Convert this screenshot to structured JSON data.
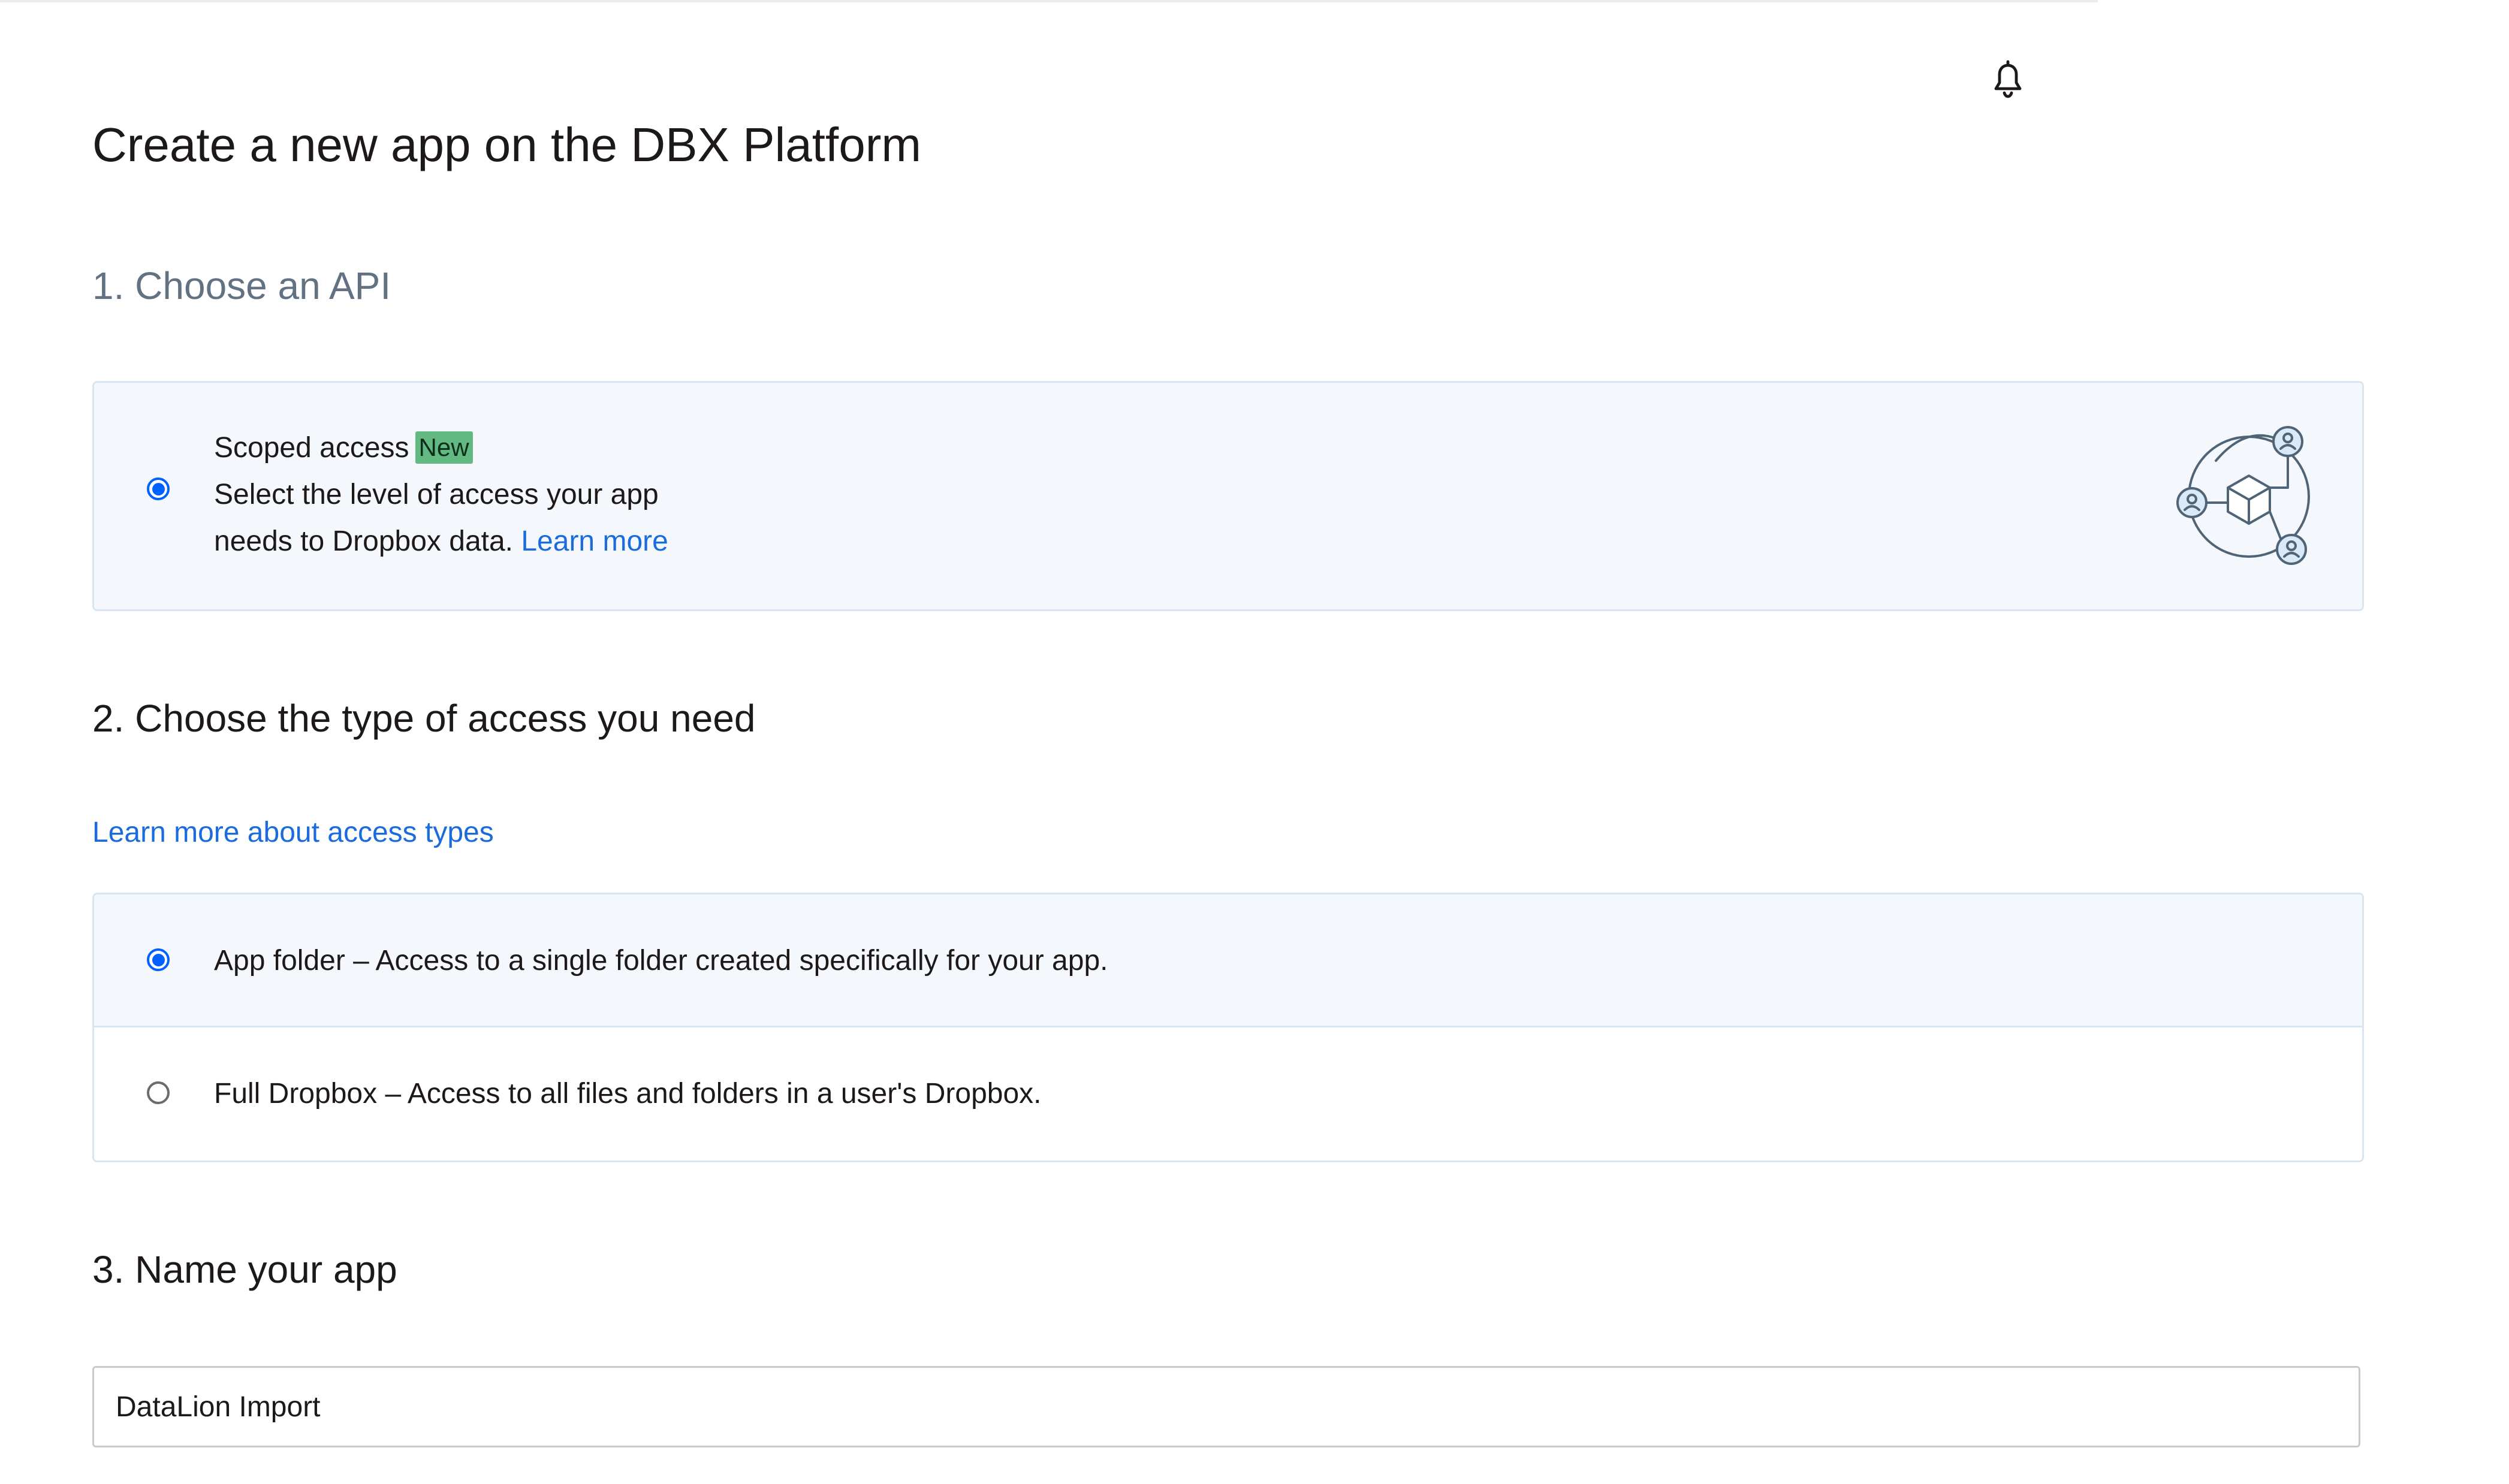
{
  "header": {
    "notifications_icon": "bell-icon"
  },
  "page": {
    "title": "Create a new app on the DBX Platform"
  },
  "step1": {
    "heading": "1. Choose an API",
    "option": {
      "title": "Scoped access",
      "badge": "New",
      "description_line1": "Select the level of access your app",
      "description_line2": "needs to Dropbox data.",
      "learn_more": "Learn more",
      "selected": true,
      "illustration_icon": "api-network-icon"
    }
  },
  "step2": {
    "heading": "2. Choose the type of access you need",
    "learn_more_link": "Learn more about access types",
    "options": [
      {
        "label": "App folder – Access to a single folder created specifically for your app.",
        "selected": true
      },
      {
        "label": "Full Dropbox – Access to all files and folders in a user's Dropbox.",
        "selected": false
      }
    ]
  },
  "step3": {
    "heading": "3. Name your app",
    "app_name_value": "DataLion Import"
  },
  "colors": {
    "accent": "#0061fe",
    "link": "#1a6bde",
    "selected_bg": "#f4f8fd",
    "border": "#d8e6f3",
    "badge_bg": "#63b982"
  }
}
